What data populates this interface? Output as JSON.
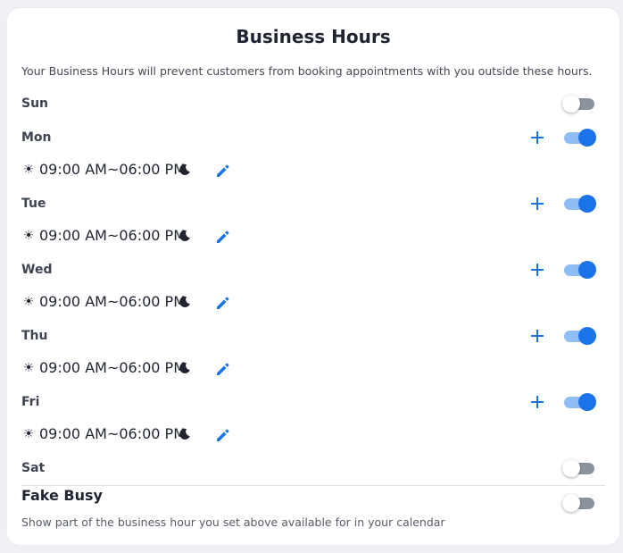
{
  "header": {
    "title": "Business Hours",
    "description": "Your Business Hours will prevent customers from booking appointments with you outside these hours."
  },
  "days": [
    {
      "label": "Sun",
      "enabled": false,
      "hours": null
    },
    {
      "label": "Mon",
      "enabled": true,
      "hours": "09:00 AM~06:00 PM"
    },
    {
      "label": "Tue",
      "enabled": true,
      "hours": "09:00 AM~06:00 PM"
    },
    {
      "label": "Wed",
      "enabled": true,
      "hours": "09:00 AM~06:00 PM"
    },
    {
      "label": "Thu",
      "enabled": true,
      "hours": "09:00 AM~06:00 PM"
    },
    {
      "label": "Fri",
      "enabled": true,
      "hours": "09:00 AM~06:00 PM"
    },
    {
      "label": "Sat",
      "enabled": false,
      "hours": null
    }
  ],
  "fake_busy": {
    "title": "Fake Busy",
    "description": "Show part of the business hour you set above available for in your calendar",
    "enabled": false
  },
  "icons": {
    "start": "sun-icon",
    "end": "moon-icon",
    "edit": "pencil-icon",
    "add": "plus-icon"
  },
  "colors": {
    "accent": "#1a73e8",
    "toggle_on_track": "#8fbdf5",
    "toggle_off_track": "#8b939e"
  }
}
